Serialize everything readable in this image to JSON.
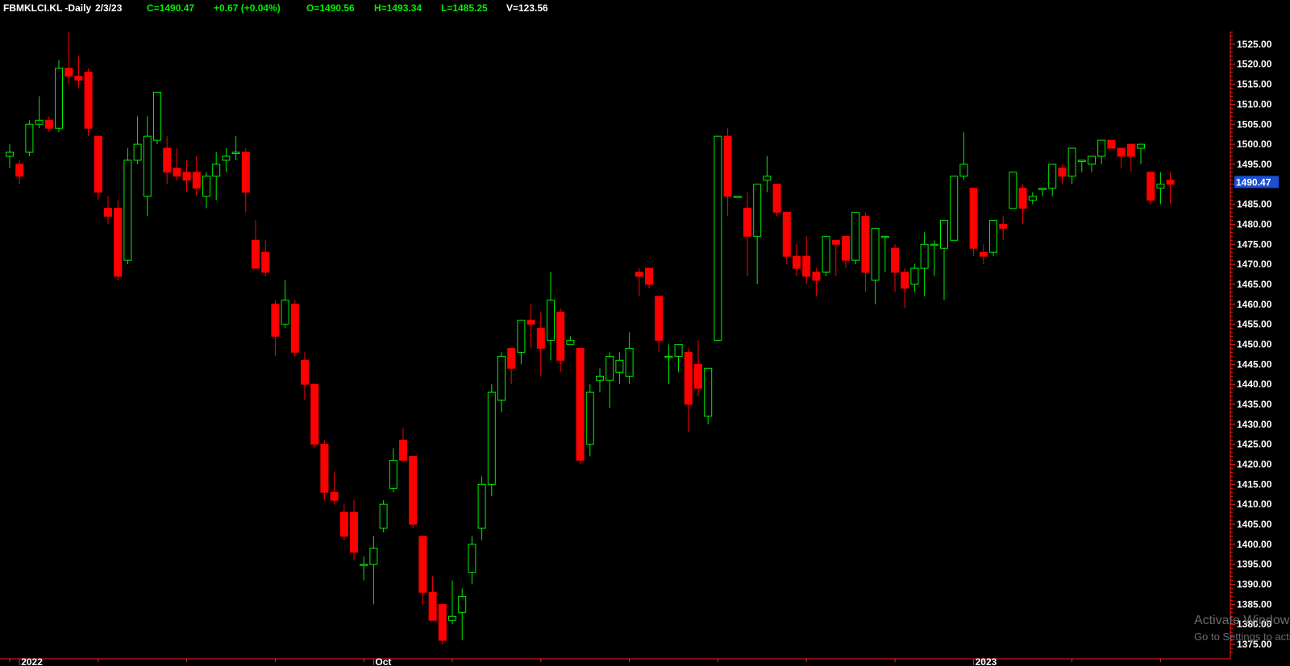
{
  "header": {
    "symbol": "FBMKLCI.KL -Daily",
    "date": "2/3/23",
    "close": "C=1490.47",
    "change": "+0.67 (+0.04%)",
    "open": "O=1490.56",
    "high": "H=1493.34",
    "low": "L=1485.25",
    "volume": "V=123.56"
  },
  "watermark": {
    "line1": "Activate Windows",
    "line2": "Go to Settings to activate Windows."
  },
  "colors": {
    "background": "#000000",
    "up": "#00ee00",
    "down": "#ff0000",
    "axis": "#ff2020",
    "text": "#ffffff",
    "price_highlight": "#1a4fd6"
  },
  "chart_data": {
    "type": "candlestick",
    "ylim": [
      1373,
      1528
    ],
    "y_ticks": [
      1375,
      1380,
      1385,
      1390,
      1395,
      1400,
      1405,
      1410,
      1415,
      1420,
      1425,
      1430,
      1435,
      1440,
      1445,
      1450,
      1455,
      1460,
      1465,
      1470,
      1475,
      1480,
      1485,
      1490,
      1495,
      1500,
      1505,
      1510,
      1515,
      1520,
      1525
    ],
    "x_labels": [
      {
        "label": "2022",
        "index": 1
      },
      {
        "label": "Oct",
        "index": 37
      },
      {
        "label": "2023",
        "index": 98
      }
    ],
    "last_price": "1490.47",
    "candles": [
      {
        "o": 1497,
        "h": 1500,
        "l": 1494,
        "c": 1498
      },
      {
        "o": 1495,
        "h": 1496,
        "l": 1490,
        "c": 1492
      },
      {
        "o": 1498,
        "h": 1506,
        "l": 1497,
        "c": 1505
      },
      {
        "o": 1505,
        "h": 1512,
        "l": 1504,
        "c": 1506
      },
      {
        "o": 1506,
        "h": 1507,
        "l": 1503,
        "c": 1504
      },
      {
        "o": 1504,
        "h": 1521,
        "l": 1503,
        "c": 1519
      },
      {
        "o": 1519,
        "h": 1528,
        "l": 1515,
        "c": 1517
      },
      {
        "o": 1517,
        "h": 1522,
        "l": 1514,
        "c": 1516
      },
      {
        "o": 1518,
        "h": 1519,
        "l": 1502,
        "c": 1504
      },
      {
        "o": 1502,
        "h": 1502,
        "l": 1486,
        "c": 1488
      },
      {
        "o": 1484,
        "h": 1487,
        "l": 1480,
        "c": 1482
      },
      {
        "o": 1484,
        "h": 1486,
        "l": 1466,
        "c": 1467
      },
      {
        "o": 1471,
        "h": 1499,
        "l": 1470,
        "c": 1496
      },
      {
        "o": 1496,
        "h": 1507,
        "l": 1495,
        "c": 1500
      },
      {
        "o": 1487,
        "h": 1507,
        "l": 1482,
        "c": 1502
      },
      {
        "o": 1501,
        "h": 1513,
        "l": 1500,
        "c": 1513
      },
      {
        "o": 1499,
        "h": 1502,
        "l": 1490,
        "c": 1493
      },
      {
        "o": 1494,
        "h": 1499,
        "l": 1491,
        "c": 1492
      },
      {
        "o": 1493,
        "h": 1496,
        "l": 1488,
        "c": 1491
      },
      {
        "o": 1493,
        "h": 1497,
        "l": 1487,
        "c": 1489
      },
      {
        "o": 1487,
        "h": 1493,
        "l": 1484,
        "c": 1492
      },
      {
        "o": 1492,
        "h": 1498,
        "l": 1486,
        "c": 1495
      },
      {
        "o": 1496,
        "h": 1499,
        "l": 1493,
        "c": 1497
      },
      {
        "o": 1498,
        "h": 1502,
        "l": 1496,
        "c": 1498
      },
      {
        "o": 1498,
        "h": 1499,
        "l": 1483,
        "c": 1488
      },
      {
        "o": 1476,
        "h": 1481,
        "l": 1470,
        "c": 1469
      },
      {
        "o": 1473,
        "h": 1476,
        "l": 1467,
        "c": 1468
      },
      {
        "o": 1460,
        "h": 1461,
        "l": 1447,
        "c": 1452
      },
      {
        "o": 1455,
        "h": 1466,
        "l": 1454,
        "c": 1461
      },
      {
        "o": 1460,
        "h": 1461,
        "l": 1447,
        "c": 1448
      },
      {
        "o": 1446,
        "h": 1448,
        "l": 1436,
        "c": 1440
      },
      {
        "o": 1440,
        "h": 1440,
        "l": 1424,
        "c": 1425
      },
      {
        "o": 1425,
        "h": 1426,
        "l": 1411,
        "c": 1413
      },
      {
        "o": 1413,
        "h": 1418,
        "l": 1410,
        "c": 1411
      },
      {
        "o": 1408,
        "h": 1410,
        "l": 1401,
        "c": 1402
      },
      {
        "o": 1408,
        "h": 1411,
        "l": 1396,
        "c": 1398
      },
      {
        "o": 1395,
        "h": 1397,
        "l": 1391,
        "c": 1395
      },
      {
        "o": 1395,
        "h": 1402,
        "l": 1385,
        "c": 1399
      },
      {
        "o": 1404,
        "h": 1411,
        "l": 1403,
        "c": 1410
      },
      {
        "o": 1414,
        "h": 1424,
        "l": 1413,
        "c": 1421
      },
      {
        "o": 1426,
        "h": 1429,
        "l": 1421,
        "c": 1421
      },
      {
        "o": 1422,
        "h": 1422,
        "l": 1404,
        "c": 1405
      },
      {
        "o": 1402,
        "h": 1402,
        "l": 1385,
        "c": 1388
      },
      {
        "o": 1388,
        "h": 1392,
        "l": 1383,
        "c": 1381
      },
      {
        "o": 1385,
        "h": 1385,
        "l": 1375,
        "c": 1376
      },
      {
        "o": 1381,
        "h": 1391,
        "l": 1380,
        "c": 1382
      },
      {
        "o": 1383,
        "h": 1389,
        "l": 1376,
        "c": 1387
      },
      {
        "o": 1393,
        "h": 1402,
        "l": 1390,
        "c": 1400
      },
      {
        "o": 1404,
        "h": 1417,
        "l": 1401,
        "c": 1415
      },
      {
        "o": 1415,
        "h": 1440,
        "l": 1412,
        "c": 1438
      },
      {
        "o": 1436,
        "h": 1448,
        "l": 1433,
        "c": 1447
      },
      {
        "o": 1449,
        "h": 1449,
        "l": 1440,
        "c": 1444
      },
      {
        "o": 1448,
        "h": 1455,
        "l": 1445,
        "c": 1456
      },
      {
        "o": 1456,
        "h": 1460,
        "l": 1449,
        "c": 1455
      },
      {
        "o": 1454,
        "h": 1458,
        "l": 1442,
        "c": 1449
      },
      {
        "o": 1451,
        "h": 1468,
        "l": 1446,
        "c": 1461
      },
      {
        "o": 1458,
        "h": 1459,
        "l": 1443,
        "c": 1446
      },
      {
        "o": 1450,
        "h": 1452,
        "l": 1450,
        "c": 1451
      },
      {
        "o": 1449,
        "h": 1449,
        "l": 1420,
        "c": 1421
      },
      {
        "o": 1425,
        "h": 1440,
        "l": 1422,
        "c": 1438
      },
      {
        "o": 1441,
        "h": 1444,
        "l": 1438,
        "c": 1442
      },
      {
        "o": 1441,
        "h": 1448,
        "l": 1434,
        "c": 1447
      },
      {
        "o": 1443,
        "h": 1448,
        "l": 1440,
        "c": 1446
      },
      {
        "o": 1442,
        "h": 1453,
        "l": 1440,
        "c": 1449
      },
      {
        "o": 1468,
        "h": 1469,
        "l": 1462,
        "c": 1467
      },
      {
        "o": 1469,
        "h": 1469,
        "l": 1464,
        "c": 1465
      },
      {
        "o": 1462,
        "h": 1462,
        "l": 1448,
        "c": 1451
      },
      {
        "o": 1447,
        "h": 1450,
        "l": 1440,
        "c": 1447
      },
      {
        "o": 1447,
        "h": 1449,
        "l": 1443,
        "c": 1450
      },
      {
        "o": 1448,
        "h": 1449,
        "l": 1428,
        "c": 1435
      },
      {
        "o": 1445,
        "h": 1451,
        "l": 1437,
        "c": 1439
      },
      {
        "o": 1432,
        "h": 1443,
        "l": 1430,
        "c": 1444
      },
      {
        "o": 1451,
        "h": 1502,
        "l": 1451,
        "c": 1502
      },
      {
        "o": 1502,
        "h": 1504,
        "l": 1482,
        "c": 1487
      },
      {
        "o": 1487,
        "h": 1487,
        "l": 1487,
        "c": 1487
      },
      {
        "o": 1484,
        "h": 1488,
        "l": 1467,
        "c": 1477
      },
      {
        "o": 1477,
        "h": 1490,
        "l": 1465,
        "c": 1490
      },
      {
        "o": 1491,
        "h": 1497,
        "l": 1488,
        "c": 1492
      },
      {
        "o": 1490,
        "h": 1490,
        "l": 1482,
        "c": 1483
      },
      {
        "o": 1483,
        "h": 1483,
        "l": 1470,
        "c": 1472
      },
      {
        "o": 1472,
        "h": 1475,
        "l": 1467,
        "c": 1469
      },
      {
        "o": 1472,
        "h": 1477,
        "l": 1465,
        "c": 1467
      },
      {
        "o": 1468,
        "h": 1469,
        "l": 1462,
        "c": 1466
      },
      {
        "o": 1468,
        "h": 1477,
        "l": 1467,
        "c": 1477
      },
      {
        "o": 1476,
        "h": 1476,
        "l": 1467,
        "c": 1475
      },
      {
        "o": 1477,
        "h": 1477,
        "l": 1469,
        "c": 1471
      },
      {
        "o": 1471,
        "h": 1483,
        "l": 1470,
        "c": 1483
      },
      {
        "o": 1482,
        "h": 1483,
        "l": 1463,
        "c": 1468
      },
      {
        "o": 1466,
        "h": 1479,
        "l": 1460,
        "c": 1479
      },
      {
        "o": 1477,
        "h": 1477,
        "l": 1468,
        "c": 1477
      },
      {
        "o": 1474,
        "h": 1475,
        "l": 1463,
        "c": 1468
      },
      {
        "o": 1468,
        "h": 1469,
        "l": 1459,
        "c": 1464
      },
      {
        "o": 1465,
        "h": 1470,
        "l": 1463,
        "c": 1469
      },
      {
        "o": 1469,
        "h": 1478,
        "l": 1462,
        "c": 1475
      },
      {
        "o": 1475,
        "h": 1476,
        "l": 1467,
        "c": 1475
      },
      {
        "o": 1474,
        "h": 1481,
        "l": 1461,
        "c": 1481
      },
      {
        "o": 1476,
        "h": 1492,
        "l": 1476,
        "c": 1492
      },
      {
        "o": 1492,
        "h": 1503,
        "l": 1491,
        "c": 1495
      },
      {
        "o": 1489,
        "h": 1489,
        "l": 1472,
        "c": 1474
      },
      {
        "o": 1473,
        "h": 1475,
        "l": 1470,
        "c": 1472
      },
      {
        "o": 1473,
        "h": 1481,
        "l": 1472,
        "c": 1481
      },
      {
        "o": 1480,
        "h": 1482,
        "l": 1476,
        "c": 1479
      },
      {
        "o": 1484,
        "h": 1493,
        "l": 1484,
        "c": 1493
      },
      {
        "o": 1489,
        "h": 1490,
        "l": 1480,
        "c": 1484
      },
      {
        "o": 1486,
        "h": 1488,
        "l": 1485,
        "c": 1487
      },
      {
        "o": 1489,
        "h": 1489,
        "l": 1487,
        "c": 1489
      },
      {
        "o": 1489,
        "h": 1495,
        "l": 1487,
        "c": 1495
      },
      {
        "o": 1494,
        "h": 1495,
        "l": 1490,
        "c": 1492
      },
      {
        "o": 1492,
        "h": 1499,
        "l": 1490,
        "c": 1499
      },
      {
        "o": 1496,
        "h": 1496,
        "l": 1493,
        "c": 1496
      },
      {
        "o": 1495,
        "h": 1497,
        "l": 1493,
        "c": 1497
      },
      {
        "o": 1497,
        "h": 1501,
        "l": 1495,
        "c": 1501
      },
      {
        "o": 1501,
        "h": 1501,
        "l": 1499,
        "c": 1499
      },
      {
        "o": 1499,
        "h": 1498,
        "l": 1494,
        "c": 1497
      },
      {
        "o": 1500,
        "h": 1500,
        "l": 1493,
        "c": 1497
      },
      {
        "o": 1499,
        "h": 1500,
        "l": 1495,
        "c": 1500
      },
      {
        "o": 1493,
        "h": 1493,
        "l": 1485,
        "c": 1486
      },
      {
        "o": 1489,
        "h": 1493,
        "l": 1485,
        "c": 1490
      },
      {
        "o": 1491,
        "h": 1493,
        "l": 1485,
        "c": 1490
      }
    ]
  }
}
